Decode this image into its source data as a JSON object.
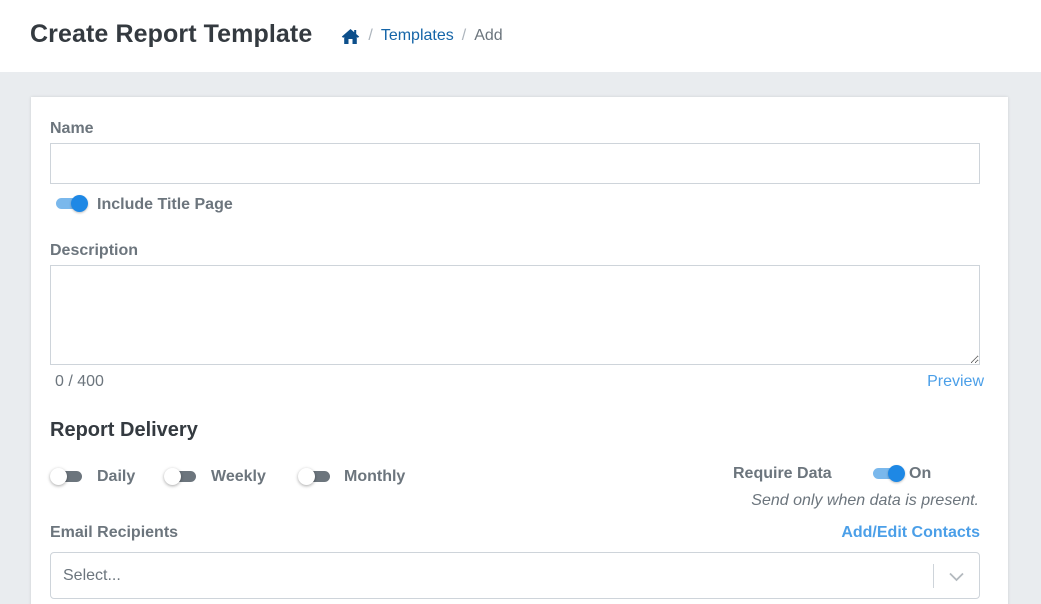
{
  "header": {
    "title": "Create Report Template",
    "breadcrumb": {
      "home_icon": "home-icon",
      "separator": "/",
      "items": [
        {
          "label": "Templates"
        },
        {
          "label": "Add"
        }
      ]
    }
  },
  "form": {
    "name": {
      "label": "Name",
      "value": "",
      "placeholder": ""
    },
    "include_title_page": {
      "label": "Include Title Page",
      "enabled": true
    },
    "description": {
      "label": "Description",
      "value": "",
      "placeholder": "",
      "counter": "0 / 400"
    },
    "preview_link": "Preview",
    "report_delivery": {
      "title": "Report Delivery",
      "options": [
        {
          "label": "Daily",
          "enabled": false
        },
        {
          "label": "Weekly",
          "enabled": false
        },
        {
          "label": "Monthly",
          "enabled": false
        }
      ],
      "require_data": {
        "label": "Require Data",
        "enabled": true,
        "state_label": "On",
        "hint": "Send only when data is present."
      }
    },
    "email_recipients": {
      "label": "Email Recipients",
      "add_edit_link": "Add/Edit Contacts",
      "select_placeholder": "Select..."
    }
  },
  "colors": {
    "accent": "#1e88e5",
    "link": "#1565a8",
    "toggle_off": "#6c757d"
  }
}
